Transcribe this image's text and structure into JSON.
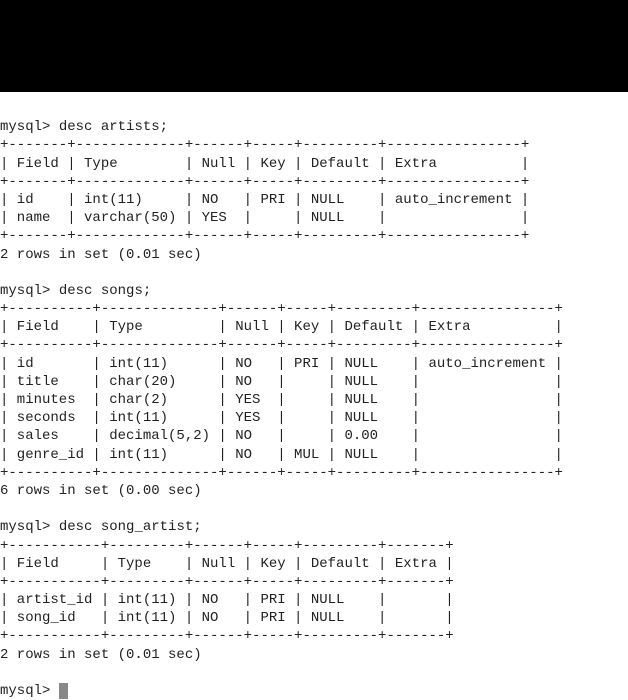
{
  "q1": {
    "prompt": "mysql>",
    "cmd": "desc artists;",
    "border_top": "+-------+-------------+------+-----+---------+----------------+",
    "header": "| Field | Type        | Null | Key | Default | Extra          |",
    "border_mid": "+-------+-------------+------+-----+---------+----------------+",
    "rows": [
      "| id    | int(11)     | NO   | PRI | NULL    | auto_increment |",
      "| name  | varchar(50) | YES  |     | NULL    |                |"
    ],
    "border_bot": "+-------+-------------+------+-----+---------+----------------+",
    "status": "2 rows in set (0.01 sec)"
  },
  "q2": {
    "prompt": "mysql>",
    "cmd": "desc songs;",
    "border_top": "+----------+--------------+------+-----+---------+----------------+",
    "header": "| Field    | Type         | Null | Key | Default | Extra          |",
    "border_mid": "+----------+--------------+------+-----+---------+----------------+",
    "rows": [
      "| id       | int(11)      | NO   | PRI | NULL    | auto_increment |",
      "| title    | char(20)     | NO   |     | NULL    |                |",
      "| minutes  | char(2)      | YES  |     | NULL    |                |",
      "| seconds  | int(11)      | YES  |     | NULL    |                |",
      "| sales    | decimal(5,2) | NO   |     | 0.00    |                |",
      "| genre_id | int(11)      | NO   | MUL | NULL    |                |"
    ],
    "border_bot": "+----------+--------------+------+-----+---------+----------------+",
    "status": "6 rows in set (0.00 sec)"
  },
  "q3": {
    "prompt": "mysql>",
    "cmd": "desc song_artist;",
    "border_top": "+-----------+---------+------+-----+---------+-------+",
    "header": "| Field     | Type    | Null | Key | Default | Extra |",
    "border_mid": "+-----------+---------+------+-----+---------+-------+",
    "rows": [
      "| artist_id | int(11) | NO   | PRI | NULL    |       |",
      "| song_id   | int(11) | NO   | PRI | NULL    |       |"
    ],
    "border_bot": "+-----------+---------+------+-----+---------+-------+",
    "status": "2 rows in set (0.01 sec)"
  },
  "final_prompt": "mysql>"
}
